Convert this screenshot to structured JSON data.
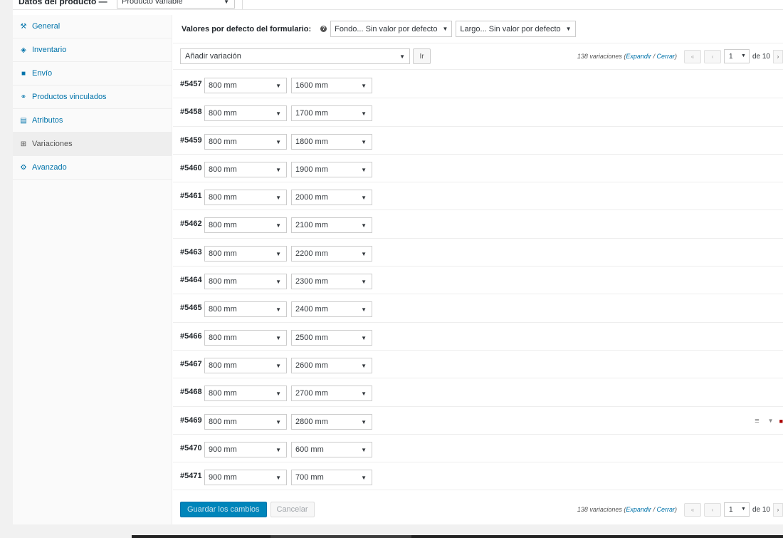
{
  "topbar": {
    "label": "Datos del producto —",
    "product_type": "Producto variable"
  },
  "sidebar": {
    "items": [
      {
        "label": "General",
        "icon": "wrench-icon",
        "glyph": "⚒"
      },
      {
        "label": "Inventario",
        "icon": "tag-icon",
        "glyph": "◈"
      },
      {
        "label": "Envío",
        "icon": "truck-icon",
        "glyph": "■"
      },
      {
        "label": "Productos vinculados",
        "icon": "link-icon",
        "glyph": "⚭"
      },
      {
        "label": "Atributos",
        "icon": "list-icon",
        "glyph": "▤"
      },
      {
        "label": "Variaciones",
        "icon": "grid-icon",
        "glyph": "⊞"
      },
      {
        "label": "Avanzado",
        "icon": "gear-icon",
        "glyph": "⚙"
      }
    ],
    "active_index": 5
  },
  "defaults": {
    "label": "Valores por defecto del formulario:",
    "help_glyph": "?",
    "fondo": "Fondo... Sin valor por defecto",
    "largo": "Largo... Sin valor por defecto"
  },
  "toolbar": {
    "add_variation": "Añadir variación",
    "go_label": "Ir",
    "count_text": "138 variaciones",
    "expand": "Expandir",
    "slash": " / ",
    "close": "Cerrar",
    "page": "1",
    "of_pages": "de 10",
    "first": "«",
    "prev": "‹",
    "next": "›"
  },
  "variations": [
    {
      "id": "#5457",
      "fondo": "800 mm",
      "largo": "1600 mm"
    },
    {
      "id": "#5458",
      "fondo": "800 mm",
      "largo": "1700 mm"
    },
    {
      "id": "#5459",
      "fondo": "800 mm",
      "largo": "1800 mm"
    },
    {
      "id": "#5460",
      "fondo": "800 mm",
      "largo": "1900 mm"
    },
    {
      "id": "#5461",
      "fondo": "800 mm",
      "largo": "2000 mm"
    },
    {
      "id": "#5462",
      "fondo": "800 mm",
      "largo": "2100 mm"
    },
    {
      "id": "#5463",
      "fondo": "800 mm",
      "largo": "2200 mm"
    },
    {
      "id": "#5464",
      "fondo": "800 mm",
      "largo": "2300 mm"
    },
    {
      "id": "#5465",
      "fondo": "800 mm",
      "largo": "2400 mm"
    },
    {
      "id": "#5466",
      "fondo": "800 mm",
      "largo": "2500 mm"
    },
    {
      "id": "#5467",
      "fondo": "800 mm",
      "largo": "2600 mm"
    },
    {
      "id": "#5468",
      "fondo": "800 mm",
      "largo": "2700 mm"
    },
    {
      "id": "#5469",
      "fondo": "800 mm",
      "largo": "2800 mm",
      "hover": true
    },
    {
      "id": "#5470",
      "fondo": "900 mm",
      "largo": "600 mm"
    },
    {
      "id": "#5471",
      "fondo": "900 mm",
      "largo": "700 mm"
    }
  ],
  "footer": {
    "save": "Guardar los cambios",
    "cancel": "Cancelar",
    "count_text": "138 variaciones",
    "expand": "Expandir",
    "slash": " / ",
    "close": "Cerrar",
    "page": "1",
    "of_pages": "de 10",
    "first": "«",
    "prev": "‹",
    "next": "›"
  }
}
